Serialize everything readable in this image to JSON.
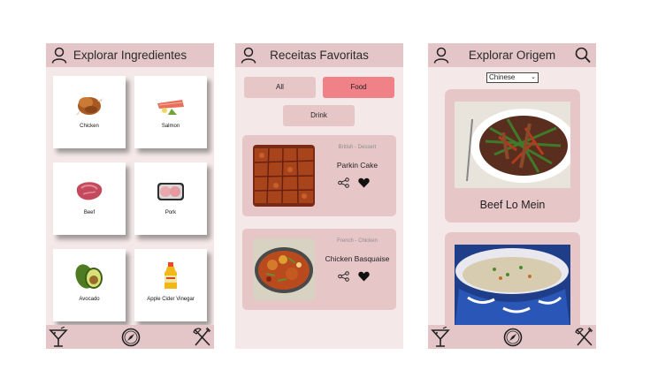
{
  "screen1": {
    "title": "Explorar Ingredientes",
    "ingredients": [
      {
        "name": "Chicken",
        "icon": "chicken-icon"
      },
      {
        "name": "Salmon",
        "icon": "salmon-icon"
      },
      {
        "name": "Beef",
        "icon": "beef-icon"
      },
      {
        "name": "Pork",
        "icon": "pork-icon"
      },
      {
        "name": "Avocado",
        "icon": "avocado-icon"
      },
      {
        "name": "Apple Cider Vinegar",
        "icon": "vinegar-bottle-icon"
      }
    ]
  },
  "screen2": {
    "title": "Receitas Favoritas",
    "filters": {
      "all": "All",
      "food": "Food",
      "drink": "Drink"
    },
    "active_filter": "Food",
    "favorites": [
      {
        "origin": "British - Dessert",
        "name": "Parkin Cake"
      },
      {
        "origin": "French - Chicken",
        "name": "Chicken Basquaise"
      }
    ]
  },
  "screen3": {
    "title": "Explorar Origem",
    "area_select": "Chinese",
    "meals": [
      {
        "name": "Beef Lo Mein"
      }
    ]
  },
  "colors": {
    "header": "#e5c6c8",
    "background": "#f4e8e8",
    "card": "#e7c6c8",
    "active": "#ef8187"
  }
}
